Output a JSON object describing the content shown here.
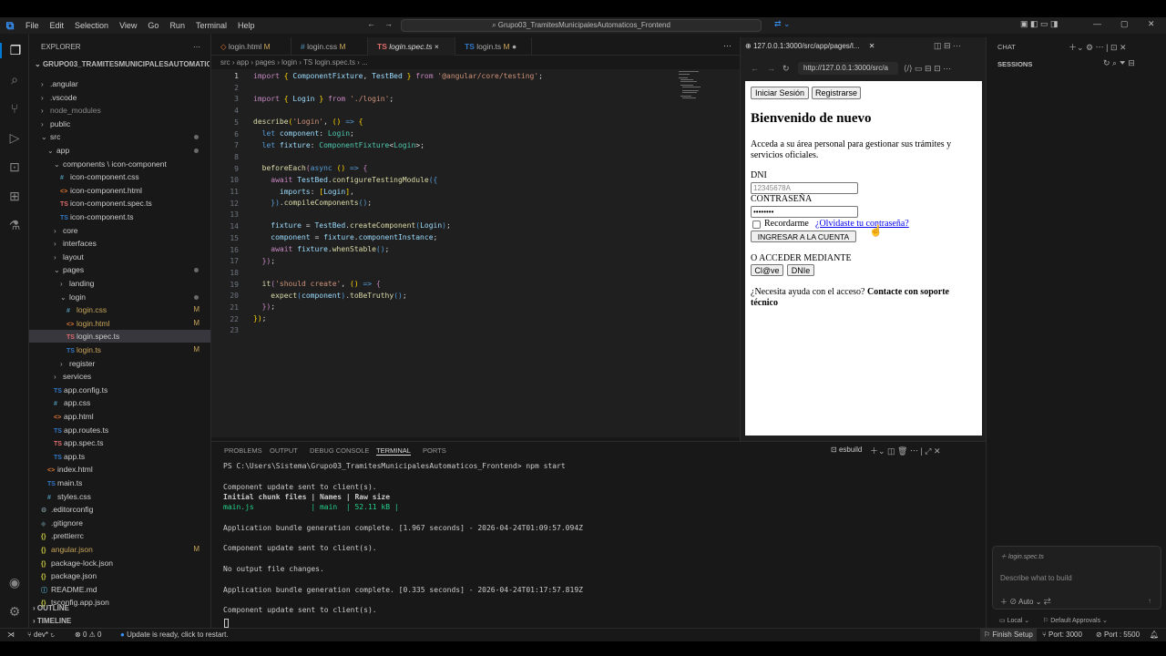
{
  "menubar": {
    "items": [
      "File",
      "Edit",
      "Selection",
      "View",
      "Go",
      "Run",
      "Terminal",
      "Help"
    ],
    "command_center": "Grupo03_TramitesMunicipalesAutomaticos_Frontend"
  },
  "sidebar": {
    "title": "EXPLORER",
    "root": "GRUPO03_TRAMITESMUNICIPALESAUTOMATICOS_...",
    "tree": [
      {
        "label": ".angular",
        "type": "folder",
        "depth": 1,
        "open": false
      },
      {
        "label": ".vscode",
        "type": "folder",
        "depth": 1,
        "open": false
      },
      {
        "label": "node_modules",
        "type": "folder",
        "depth": 1,
        "open": false,
        "dim": true
      },
      {
        "label": "public",
        "type": "folder",
        "depth": 1,
        "open": false
      },
      {
        "label": "src",
        "type": "folder",
        "depth": 1,
        "open": true,
        "dot": true
      },
      {
        "label": "app",
        "type": "folder",
        "depth": 2,
        "open": true,
        "dot": true
      },
      {
        "label": "components \\ icon-component",
        "type": "folder",
        "depth": 3,
        "open": true
      },
      {
        "label": "icon-component.css",
        "type": "css",
        "depth": 4
      },
      {
        "label": "icon-component.html",
        "type": "html",
        "depth": 4
      },
      {
        "label": "icon-component.spec.ts",
        "type": "ts",
        "depth": 4
      },
      {
        "label": "icon-component.ts",
        "type": "ts",
        "depth": 4
      },
      {
        "label": "core",
        "type": "folder",
        "depth": 3,
        "open": false
      },
      {
        "label": "interfaces",
        "type": "folder",
        "depth": 3,
        "open": false
      },
      {
        "label": "layout",
        "type": "folder",
        "depth": 3,
        "open": false
      },
      {
        "label": "pages",
        "type": "folder",
        "depth": 3,
        "open": true,
        "dot": true
      },
      {
        "label": "landing",
        "type": "folder",
        "depth": 4,
        "open": false
      },
      {
        "label": "login",
        "type": "folder",
        "depth": 4,
        "open": true,
        "dot": true
      },
      {
        "label": "login.css",
        "type": "css",
        "depth": 5,
        "badge": "M"
      },
      {
        "label": "login.html",
        "type": "html",
        "depth": 5,
        "badge": "M"
      },
      {
        "label": "login.spec.ts",
        "type": "ts",
        "depth": 5,
        "selected": true
      },
      {
        "label": "login.ts",
        "type": "ts",
        "depth": 5,
        "badge": "M"
      },
      {
        "label": "register",
        "type": "folder",
        "depth": 4,
        "open": false
      },
      {
        "label": "services",
        "type": "folder",
        "depth": 3,
        "open": false
      },
      {
        "label": "app.config.ts",
        "type": "ts",
        "depth": 3
      },
      {
        "label": "app.css",
        "type": "css",
        "depth": 3
      },
      {
        "label": "app.html",
        "type": "html",
        "depth": 3
      },
      {
        "label": "app.routes.ts",
        "type": "ts",
        "depth": 3
      },
      {
        "label": "app.spec.ts",
        "type": "ts",
        "depth": 3
      },
      {
        "label": "app.ts",
        "type": "ts",
        "depth": 3
      },
      {
        "label": "index.html",
        "type": "html",
        "depth": 2
      },
      {
        "label": "main.ts",
        "type": "ts",
        "depth": 2
      },
      {
        "label": "styles.css",
        "type": "css",
        "depth": 2
      },
      {
        "label": ".editorconfig",
        "type": "gear",
        "depth": 1
      },
      {
        "label": ".gitignore",
        "type": "git",
        "depth": 1
      },
      {
        "label": ".prettierrc",
        "type": "json",
        "depth": 1
      },
      {
        "label": "angular.json",
        "type": "json",
        "depth": 1,
        "badge": "M"
      },
      {
        "label": "package-lock.json",
        "type": "json",
        "depth": 1
      },
      {
        "label": "package.json",
        "type": "json",
        "depth": 1
      },
      {
        "label": "README.md",
        "type": "info",
        "depth": 1
      },
      {
        "label": "tsconfig.app.json",
        "type": "json",
        "depth": 1
      }
    ],
    "outline": "OUTLINE",
    "timeline": "TIMELINE"
  },
  "editor": {
    "tabs": [
      {
        "label": "login.html",
        "badge": "M",
        "type": "html"
      },
      {
        "label": "login.css",
        "badge": "M",
        "type": "css"
      },
      {
        "label": "login.spec.ts",
        "badge": "×",
        "type": "ts",
        "active": true
      },
      {
        "label": "login.ts",
        "badge": "M",
        "type": "ts"
      }
    ],
    "breadcrumb": [
      "src",
      "app",
      "pages",
      "login",
      "TS login.spec.ts",
      "..."
    ],
    "lines": [
      "1",
      "2",
      "3",
      "4",
      "5",
      "6",
      "7",
      "8",
      "9",
      "10",
      "11",
      "12",
      "13",
      "14",
      "15",
      "16",
      "17",
      "18",
      "19",
      "20",
      "21",
      "22",
      "23"
    ]
  },
  "browser": {
    "tab_title": "127.0.0.1:3000/src/app/pages/l...",
    "url": "http://127.0.0.1:3000/src/a",
    "page": {
      "btn_login": "Iniciar Sesión",
      "btn_register": "Registrarse",
      "heading": "Bienvenido de nuevo",
      "intro": "Acceda a su área personal para gestionar sus trámites y servicios oficiales.",
      "dni_label": "DNI",
      "dni_placeholder": "12345678A",
      "pwd_label": "CONTRASEÑA",
      "pwd_value": "••••••••",
      "remember": "Recordarme",
      "forgot": "¿Olvidaste tu contraseña?",
      "submit": "INGRESAR A LA CUENTA",
      "alt_access": "O ACCEDER MEDIANTE",
      "clave": "Cl@ve",
      "dnie": "DNIe",
      "help_prefix": "¿Necesita ayuda con el acceso?",
      "help_link": "Contacte con soporte técnico"
    }
  },
  "chat": {
    "title": "CHAT",
    "sessions": "SESSIONS",
    "context_file": "login.spec.ts",
    "input_placeholder": "Describe what to build",
    "mode": "Auto",
    "location": "Local",
    "approvals": "Default Approvals"
  },
  "panel": {
    "tabs": [
      "PROBLEMS",
      "OUTPUT",
      "DEBUG CONSOLE",
      "TERMINAL",
      "PORTS"
    ],
    "active_tab": "TERMINAL",
    "shell": "esbuild",
    "terminal_lines": [
      "PS C:\\Users\\Sistema\\Grupo03_TramitesMunicipalesAutomaticos_Frontend> npm start",
      "",
      "Component update sent to client(s).",
      "Initial chunk files | Names | Raw size",
      "main.js             | main  | 52.11 kB |",
      "",
      "Application bundle generation complete. [1.967 seconds] - 2026-04-24T01:09:57.094Z",
      "",
      "Component update sent to client(s).",
      "",
      "No output file changes.",
      "",
      "Application bundle generation complete. [0.335 seconds] - 2026-04-24T01:17:57.819Z",
      "",
      "Component update sent to client(s)."
    ]
  },
  "statusbar": {
    "branch": "dev*",
    "errors": "0",
    "warnings": "0",
    "update": "Update is ready, click to restart.",
    "finish_setup": "Finish Setup",
    "port1": "Port: 3000",
    "port2": "Port : 5500"
  },
  "colors": {
    "accent": "#0078d4",
    "modified": "#c8a55a",
    "background": "#181818",
    "editor_bg": "#1f1f1f"
  }
}
